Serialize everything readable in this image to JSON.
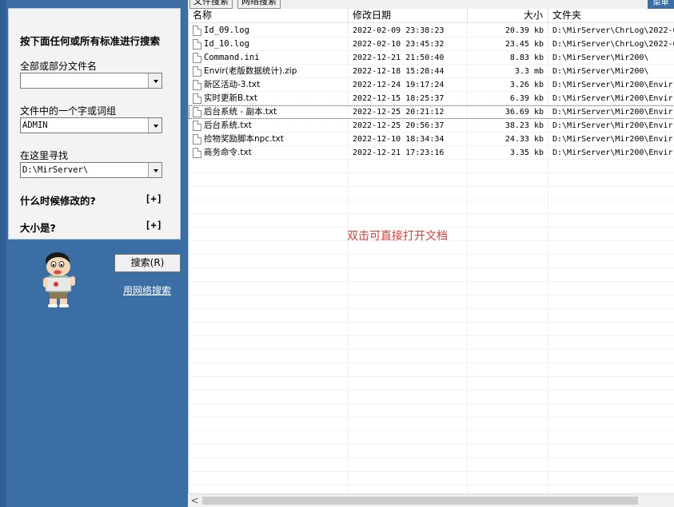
{
  "sidebar": {
    "title": "按下面任何或所有标准进行搜索",
    "filename_label": "全部或部分文件名",
    "filename_value": "",
    "content_label": "文件中的一个字或词组",
    "content_value": "ADMIN",
    "location_label": "在这里寻找",
    "location_value": "D:\\MirServer\\",
    "modified_label": "什么时候修改的?",
    "modified_expand": "[+]",
    "size_label": "大小是?",
    "size_expand": "[+]",
    "search_button": "搜索(R)",
    "web_search_link": "用网络搜索"
  },
  "tabs": [
    {
      "label": "文件搜索"
    },
    {
      "label": "网络搜索"
    }
  ],
  "menu_label": "菜单",
  "columns": {
    "name": "名称",
    "date": "修改日期",
    "size": "大小",
    "folder": "文件夹"
  },
  "files": [
    {
      "name": "Id_09.log",
      "date": "2022-02-09 23:38:23",
      "size": "20.39 kb",
      "folder": "D:\\MirServer\\ChrLog\\2022-0"
    },
    {
      "name": "Id_10.log",
      "date": "2022-02-10 23:45:32",
      "size": "23.45 kb",
      "folder": "D:\\MirServer\\ChrLog\\2022-0"
    },
    {
      "name": "Command.ini",
      "date": "2022-12-21 21:50:40",
      "size": "8.83 kb",
      "folder": "D:\\MirServer\\Mir200\\"
    },
    {
      "name": "Envir(老版数据统计).zip",
      "date": "2022-12-18 15:28:44",
      "size": "3.3 mb",
      "folder": "D:\\MirServer\\Mir200\\"
    },
    {
      "name": "新区活动-3.txt",
      "date": "2022-12-24 19:17:24",
      "size": "3.26 kb",
      "folder": "D:\\MirServer\\Mir200\\Envir"
    },
    {
      "name": "实时更新B.txt",
      "date": "2022-12-15 18:25:37",
      "size": "6.39 kb",
      "folder": "D:\\MirServer\\Mir200\\Envir"
    },
    {
      "name": "后台系统 - 副本.txt",
      "date": "2022-12-25 20:21:12",
      "size": "36.69 kb",
      "folder": "D:\\MirServer\\Mir200\\Envir"
    },
    {
      "name": "后台系统.txt",
      "date": "2022-12-25 20:56:37",
      "size": "38.23 kb",
      "folder": "D:\\MirServer\\Mir200\\Envir"
    },
    {
      "name": "捡物奖励脚本npc.txt",
      "date": "2022-12-10 18:34:34",
      "size": "24.33 kb",
      "folder": "D:\\MirServer\\Mir200\\Envir"
    },
    {
      "name": "商务命令.txt",
      "date": "2022-12-21 17:23:16",
      "size": "3.35 kb",
      "folder": "D:\\MirServer\\Mir200\\Envir"
    }
  ],
  "hint_text": "双击可直接打开文档",
  "scroll_left_glyph": "<"
}
